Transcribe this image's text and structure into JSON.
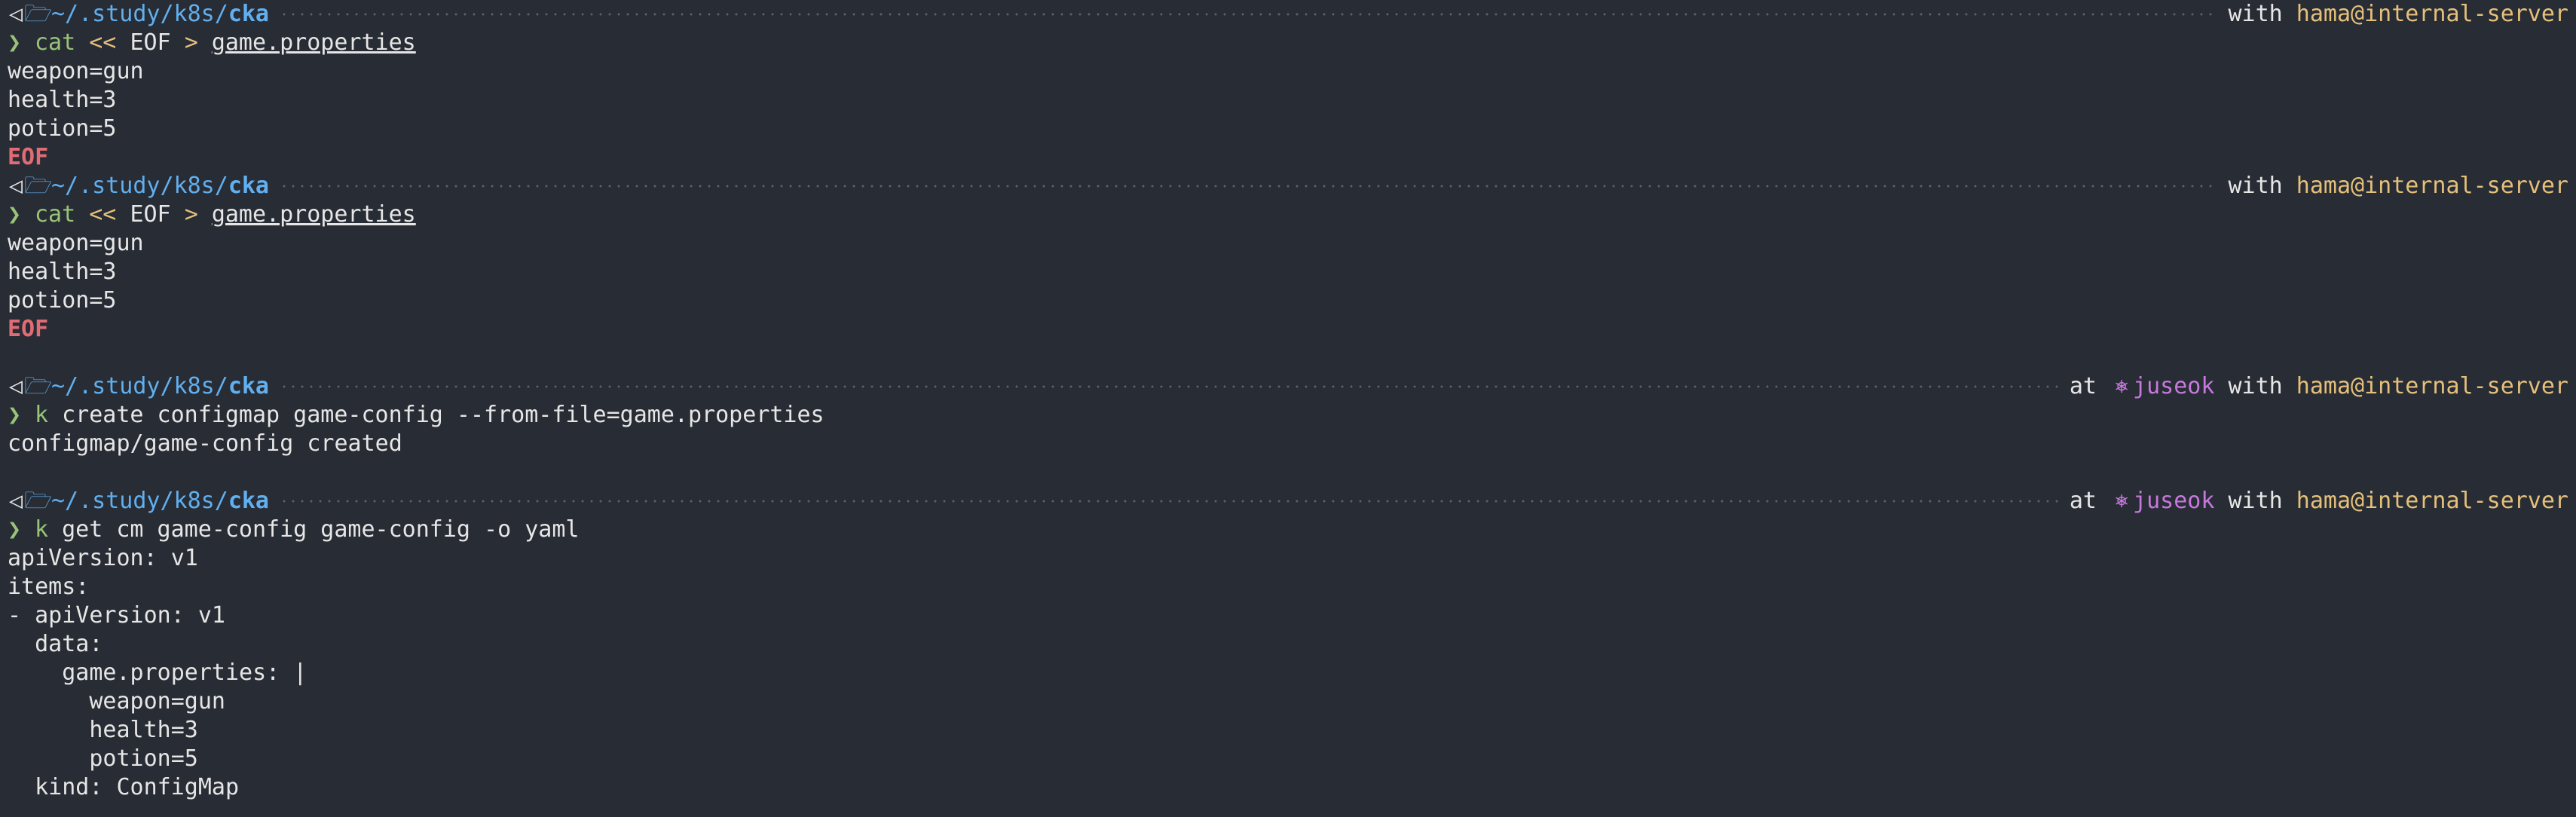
{
  "prompt": {
    "os_icon": "◁",
    "dir_icon": "🗁",
    "path_prefix": "~/.study/k8s/",
    "path_last": "cka",
    "with_word": "with",
    "at_word": "at",
    "user_host": "hama@internal-server",
    "context_icon": "⎈",
    "context": "juseok",
    "chevron": "❯"
  },
  "blocks": [
    {
      "show_context": false,
      "command": {
        "name": "cat",
        "op1": "<<",
        "arg1": "EOF",
        "op2": ">",
        "file": "game.properties"
      },
      "heredoc": [
        "weapon=gun",
        "health=3",
        "potion=5"
      ],
      "terminator": "EOF"
    },
    {
      "show_context": false,
      "command": {
        "name": "cat",
        "op1": "<<",
        "arg1": "EOF",
        "op2": ">",
        "file": "game.properties"
      },
      "heredoc": [
        "weapon=gun",
        "health=3",
        "potion=5"
      ],
      "terminator": "EOF"
    },
    {
      "show_context": true,
      "command_text": {
        "name": "k",
        "rest": "create configmap game-config --from-file=game.properties"
      },
      "output": [
        "configmap/game-config created"
      ]
    },
    {
      "show_context": true,
      "command_text": {
        "name": "k",
        "rest": "get cm game-config game-config -o yaml"
      },
      "output": [
        "apiVersion: v1",
        "items:",
        "- apiVersion: v1",
        "  data:",
        "    game.properties: |",
        "      weapon=gun",
        "      health=3",
        "      potion=5",
        "  kind: ConfigMap"
      ]
    }
  ],
  "colors": {
    "background": "#282c34",
    "path": "#61afef",
    "user": "#e5c07b",
    "context": "#c678dd",
    "chevron": "#98c379",
    "eof": "#e06c75"
  }
}
